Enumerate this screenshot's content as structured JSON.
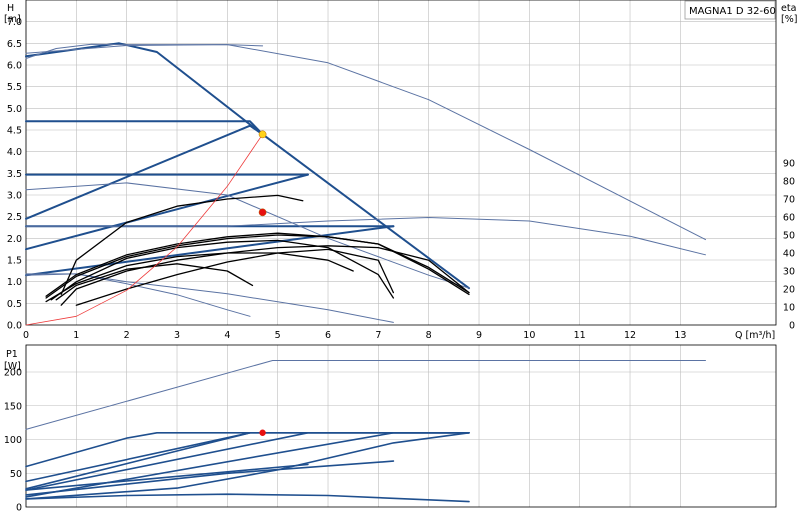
{
  "title": "MAGNA1 D 32-60",
  "chart_data": [
    {
      "type": "line",
      "title": "MAGNA1 D 32-60",
      "xlabel": "Q [m³/h]",
      "ylabel": "H\n[m]",
      "y2label": "eta\n[%]",
      "xlim": [
        0,
        14.9
      ],
      "ylim": [
        0,
        7.5
      ],
      "y2lim": [
        0,
        90
      ],
      "xticks": [
        "0",
        "1",
        "2",
        "3",
        "4",
        "5",
        "6",
        "7",
        "8",
        "9",
        "10",
        "11",
        "12",
        "13"
      ],
      "yticks": [
        "0.0",
        "0.5",
        "1.0",
        "1.5",
        "2.0",
        "2.5",
        "3.0",
        "3.5",
        "4.0",
        "4.5",
        "5.0",
        "5.5",
        "6.0",
        "6.5",
        "7.0"
      ],
      "y2ticks": [
        "0",
        "10",
        "20",
        "30",
        "40",
        "50",
        "60",
        "70",
        "80",
        "90"
      ],
      "grid": true,
      "series": [
        {
          "group": "control",
          "x": [
            0,
            1.85,
            2.6,
            4.7,
            8.8
          ],
          "y": [
            6.2,
            6.5,
            6.3,
            4.4,
            0.85
          ]
        },
        {
          "group": "control",
          "x": [
            0,
            4.45,
            4.7
          ],
          "y": [
            4.7,
            4.7,
            4.4
          ]
        },
        {
          "group": "control",
          "x": [
            0,
            4.45,
            4.7
          ],
          "y": [
            2.45,
            4.6,
            4.4
          ]
        },
        {
          "group": "control",
          "x": [
            0,
            5.6
          ],
          "y": [
            3.47,
            3.47
          ]
        },
        {
          "group": "control",
          "x": [
            0,
            5.6
          ],
          "y": [
            1.75,
            3.47
          ]
        },
        {
          "group": "control",
          "x": [
            0,
            7.3
          ],
          "y": [
            2.28,
            2.28
          ]
        },
        {
          "group": "control",
          "x": [
            0,
            7.3
          ],
          "y": [
            1.15,
            2.28
          ]
        },
        {
          "group": "pump",
          "x": [
            0,
            0.6,
            1.3,
            1.9,
            4.0,
            4.7
          ],
          "y": [
            6.15,
            6.38,
            6.48,
            6.47,
            6.47,
            6.44
          ]
        },
        {
          "group": "pump",
          "x": [
            0,
            2,
            4,
            6,
            8,
            10,
            13.5
          ],
          "y": [
            6.27,
            6.45,
            6.47,
            6.05,
            5.2,
            4.05,
            1.97
          ]
        },
        {
          "group": "pump",
          "x": [
            0,
            2,
            4,
            6,
            8,
            8.8
          ],
          "y": [
            3.12,
            3.28,
            3.0,
            2.0,
            1.15,
            0.85
          ]
        },
        {
          "group": "pump",
          "x": [
            0,
            4,
            6,
            8,
            10,
            12,
            13.5
          ],
          "y": [
            2.28,
            2.28,
            2.4,
            2.48,
            2.4,
            2.05,
            1.62
          ]
        },
        {
          "group": "pump",
          "x": [
            0,
            1,
            2,
            4,
            6,
            7.3
          ],
          "y": [
            1.15,
            1.18,
            1.0,
            0.72,
            0.35,
            0.06
          ]
        },
        {
          "group": "pump",
          "x": [
            0,
            1,
            2,
            3,
            4,
            4.45
          ],
          "y": [
            1.18,
            1.18,
            0.95,
            0.7,
            0.35,
            0.2
          ]
        },
        {
          "group": "eta",
          "x": [
            0.4,
            1,
            2,
            3,
            4,
            5,
            6,
            7,
            8,
            8.8
          ],
          "y": [
            15,
            27,
            38,
            44,
            48,
            50,
            49,
            45,
            32,
            18
          ]
        },
        {
          "group": "eta",
          "x": [
            0.4,
            1,
            2,
            3,
            4,
            5,
            6,
            7,
            8,
            8.8
          ],
          "y": [
            16,
            28,
            39,
            45,
            49,
            51,
            49,
            45,
            31,
            17
          ]
        },
        {
          "group": "eta",
          "x": [
            0.5,
            1,
            2,
            3,
            4,
            5,
            6,
            7,
            7.3
          ],
          "y": [
            14,
            24,
            37,
            43,
            46,
            47,
            43,
            28,
            15
          ]
        },
        {
          "group": "eta",
          "x": [
            0.4,
            1,
            2,
            3,
            4,
            5,
            6,
            6.5
          ],
          "y": [
            13,
            23,
            33,
            38,
            40,
            40,
            36,
            30
          ]
        },
        {
          "group": "eta",
          "x": [
            0.6,
            1,
            2,
            3,
            4,
            4.5
          ],
          "y": [
            14,
            22,
            31,
            34,
            30,
            22
          ]
        },
        {
          "group": "eta",
          "x": [
            0.7,
            1,
            2,
            3,
            4,
            5,
            5.5
          ],
          "y": [
            17,
            36,
            57,
            66,
            70,
            72,
            69
          ]
        },
        {
          "group": "eta",
          "x": [
            0.7,
            1,
            2,
            3,
            4,
            5,
            6,
            7,
            8,
            8.8
          ],
          "y": [
            11,
            20,
            30,
            36,
            40,
            43,
            44,
            43,
            36,
            18
          ]
        },
        {
          "group": "eta",
          "x": [
            1,
            2,
            3,
            4,
            5,
            6,
            7,
            7.3
          ],
          "y": [
            11,
            20,
            28,
            35,
            40,
            42,
            36,
            18
          ]
        },
        {
          "group": "system",
          "x": [
            0,
            1,
            2,
            3,
            4,
            4.7
          ],
          "y": [
            0,
            0.2,
            0.8,
            1.8,
            3.2,
            4.4
          ]
        }
      ],
      "markers": [
        {
          "x": 4.7,
          "y": 4.4,
          "color": "#ffd21a"
        },
        {
          "x": 4.7,
          "y": 2.6,
          "color": "#e81010"
        }
      ]
    },
    {
      "type": "line",
      "ylabel": "P1\n[W]",
      "xlim": [
        0,
        14.9
      ],
      "ylim": [
        0,
        240
      ],
      "yticks": [
        "0",
        "50",
        "100",
        "150",
        "200"
      ],
      "grid": true,
      "series": [
        {
          "group": "max",
          "x": [
            0,
            4.9,
            13.5
          ],
          "y": [
            115,
            217,
            217
          ]
        },
        {
          "group": "power",
          "x": [
            0,
            2,
            2.6,
            8.8
          ],
          "y": [
            60,
            102,
            110,
            110
          ]
        },
        {
          "group": "power",
          "x": [
            0,
            4.45,
            8.8
          ],
          "y": [
            38,
            110,
            110
          ]
        },
        {
          "group": "power",
          "x": [
            0,
            5.6,
            8.8
          ],
          "y": [
            25,
            110,
            110
          ]
        },
        {
          "group": "power",
          "x": [
            0,
            7.3,
            8.8
          ],
          "y": [
            15,
            110,
            110
          ]
        },
        {
          "group": "power",
          "x": [
            0,
            3,
            4.45
          ],
          "y": [
            27,
            83,
            110
          ]
        },
        {
          "group": "power",
          "x": [
            0,
            5.6
          ],
          "y": [
            25,
            63
          ]
        },
        {
          "group": "power",
          "x": [
            0,
            4,
            7.3
          ],
          "y": [
            18,
            50,
            68
          ]
        },
        {
          "group": "power",
          "x": [
            0,
            3,
            5,
            7.3,
            8.8
          ],
          "y": [
            12,
            28,
            55,
            95,
            110
          ]
        },
        {
          "group": "power",
          "x": [
            0,
            2,
            4,
            6,
            8.8
          ],
          "y": [
            12,
            17,
            19,
            17,
            8
          ]
        }
      ],
      "markers": [
        {
          "x": 4.7,
          "y": 110,
          "color": "#e81010"
        }
      ]
    }
  ],
  "colors": {
    "control": "#1f4f8e",
    "pump": "#5b73a3",
    "eta": "#000000",
    "system": "#ee3b3b",
    "grid": "#bdbdbd"
  }
}
